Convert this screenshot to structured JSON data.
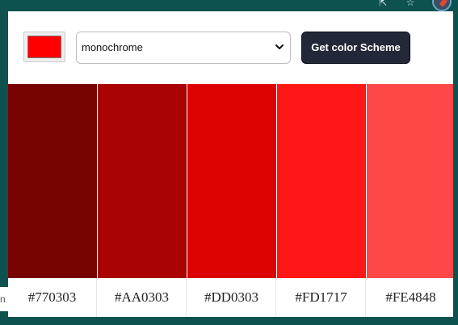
{
  "browser": {
    "icons": [
      "share-icon",
      "star-icon",
      "profile-avatar-icon"
    ],
    "background_color": "#0e5250"
  },
  "controls": {
    "seed_color": "#ff0000",
    "mode_select": {
      "selected": "monochrome"
    },
    "button_label": "Get color Scheme",
    "button_color": "#222838"
  },
  "left_fragment": {
    "text": "n"
  },
  "palette": {
    "colors": [
      {
        "hex": "#770303",
        "label": "#770303"
      },
      {
        "hex": "#AA0303",
        "label": "#AA0303"
      },
      {
        "hex": "#DD0303",
        "label": "#DD0303"
      },
      {
        "hex": "#FD1717",
        "label": "#FD1717"
      },
      {
        "hex": "#FE4848",
        "label": "#FE4848"
      }
    ]
  }
}
